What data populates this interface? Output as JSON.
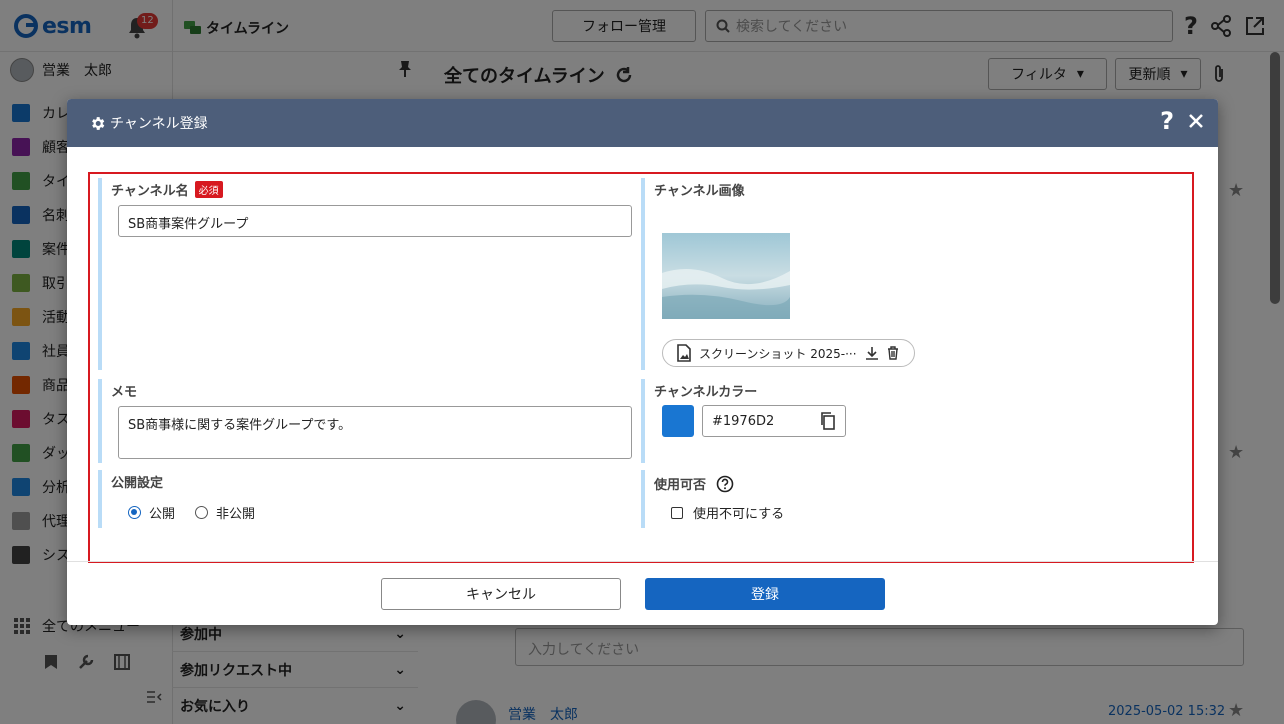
{
  "app": {
    "logo_text": "esm",
    "notification_count": "12",
    "breadcrumb": "タイムライン",
    "follow_button": "フォロー管理",
    "search_placeholder": "検索してください",
    "help": "?"
  },
  "sidebar": {
    "user_name": "営業　太郎",
    "items": [
      {
        "label": "カレ",
        "color": "#1976D2"
      },
      {
        "label": "顧客",
        "color": "#8E24AA"
      },
      {
        "label": "タイ",
        "color": "#43A047"
      },
      {
        "label": "名刺",
        "color": "#1565C0"
      },
      {
        "label": "案件",
        "color": "#00897B"
      },
      {
        "label": "取引",
        "color": "#7CB342"
      },
      {
        "label": "活動",
        "color": "#F9A825"
      },
      {
        "label": "社員",
        "color": "#1E88E5"
      },
      {
        "label": "商品",
        "color": "#E65100"
      },
      {
        "label": "タス",
        "color": "#D81B60"
      },
      {
        "label": "ダッ",
        "color": "#43A047"
      },
      {
        "label": "分析",
        "color": "#1E88E5"
      },
      {
        "label": "代理",
        "color": "#9E9E9E"
      },
      {
        "label": "シス",
        "color": "#424242"
      }
    ],
    "all_menu": "全てのメニュー"
  },
  "channel_panel": {
    "groups": [
      "参加中",
      "参加リクエスト中",
      "お気に入り"
    ]
  },
  "main": {
    "title": "全てのタイムライン",
    "filter_button": "フィルタ",
    "sort_button": "更新順",
    "comment_placeholder": "入力してください",
    "post_user": "営業　太郎",
    "post_date": "2025-05-02 15:32"
  },
  "modal": {
    "title": "チャンネル登録",
    "help": "?",
    "fields": {
      "name_label": "チャンネル名",
      "required_badge": "必須",
      "name_value": "SB商事案件グループ",
      "image_label": "チャンネル画像",
      "image_file_name": "スクリーンショット 2025-···",
      "memo_label": "メモ",
      "memo_value": "SB商事様に関する案件グループです。",
      "color_label": "チャンネルカラー",
      "color_value": "#1976D2",
      "visibility_label": "公開設定",
      "visibility_options": [
        "公開",
        "非公開"
      ],
      "visibility_selected": "公開",
      "usage_label": "使用可否",
      "usage_checkbox_label": "使用不可にする",
      "usage_checked": false
    },
    "cancel_button": "キャンセル",
    "submit_button": "登録"
  }
}
